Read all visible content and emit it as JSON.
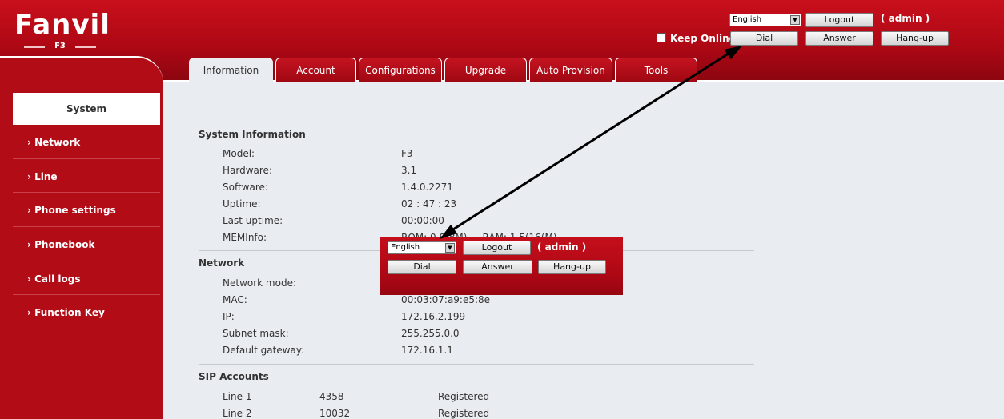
{
  "header": {
    "logo": "Fanvil",
    "model": "F3",
    "language": "English",
    "logout_label": "Logout",
    "user": "( admin )",
    "keep_online_label": "Keep Online",
    "dial_label": "Dial",
    "answer_label": "Answer",
    "hangup_label": "Hang-up"
  },
  "tabs": [
    "Information",
    "Account",
    "Configurations",
    "Upgrade",
    "Auto Provision",
    "Tools"
  ],
  "sidebar": {
    "items": [
      {
        "label": "System"
      },
      {
        "label": "› Network"
      },
      {
        "label": "› Line"
      },
      {
        "label": "› Phone settings"
      },
      {
        "label": "› Phonebook"
      },
      {
        "label": "› Call logs"
      },
      {
        "label": "› Function Key"
      }
    ]
  },
  "system_info": {
    "title": "System Information",
    "rows": [
      {
        "label": "Model:",
        "value": "F3"
      },
      {
        "label": "Hardware:",
        "value": "3.1"
      },
      {
        "label": "Software:",
        "value": "1.4.0.2271"
      },
      {
        "label": "Uptime:",
        "value": "02 : 47 : 23"
      },
      {
        "label": "Last uptime:",
        "value": "00:00:00"
      },
      {
        "label": "MEMInfo:",
        "value": "ROM: 0.8(8M)     RAM: 1.5(16(M)"
      }
    ]
  },
  "network": {
    "title": "Network",
    "rows": [
      {
        "label": "Network mode:",
        "value": ""
      },
      {
        "label": "MAC:",
        "value": "00:03:07:a9:e5:8e"
      },
      {
        "label": "IP:",
        "value": "172.16.2.199"
      },
      {
        "label": "Subnet mask:",
        "value": "255.255.0.0"
      },
      {
        "label": "Default gateway:",
        "value": "172.16.1.1"
      }
    ]
  },
  "sip_accounts": {
    "title": "SIP Accounts",
    "rows": [
      {
        "line": "Line 1",
        "number": "4358",
        "status": "Registered"
      },
      {
        "line": "Line 2",
        "number": "10032",
        "status": "Registered"
      }
    ]
  },
  "popup": {
    "language": "English",
    "logout_label": "Logout",
    "user": "( admin )",
    "dial_label": "Dial",
    "answer_label": "Answer",
    "hangup_label": "Hang-up"
  },
  "colors": {
    "brand_red": "#b00815",
    "content_bg": "#e9edf1"
  }
}
